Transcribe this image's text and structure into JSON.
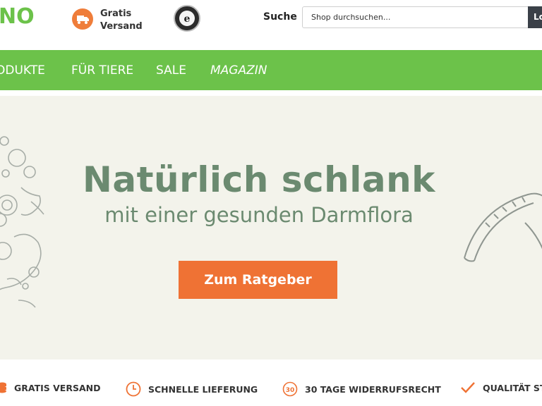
{
  "header": {
    "logo_text": "NO",
    "shipping": {
      "line1": "Gratis",
      "line2": "Versand",
      "icon": "truck-icon"
    },
    "trust_badge_icon": "trusted-shops-badge-icon",
    "search": {
      "label": "Suche",
      "placeholder": "Shop durchsuchen...",
      "button_label": "Los"
    }
  },
  "nav": {
    "items": [
      {
        "label": "ODUKTE"
      },
      {
        "label": "FÜR TIERE"
      },
      {
        "label": "SALE"
      },
      {
        "label": "MAGAZIN"
      }
    ]
  },
  "hero": {
    "title": "Natürlich schlank",
    "subtitle": "mit einer gesunden Darmflora",
    "cta_label": "Zum Ratgeber"
  },
  "usp": {
    "items": [
      {
        "label": "GRATIS VERSAND",
        "icon": "coins-icon"
      },
      {
        "label": "SCHNELLE LIEFERUNG",
        "icon": "clock-icon"
      },
      {
        "label": "30 TAGE WIDERRUFSRECHT",
        "icon": "30-days-icon",
        "icon_text": "30"
      },
      {
        "label": "QUALITÄT STA",
        "icon": "checkmark-icon"
      }
    ]
  },
  "colors": {
    "brand_green": "#6cc24a",
    "accent_orange": "#ef7234",
    "hero_text": "#6b8a70",
    "hero_bg": "#f3f3eb"
  }
}
